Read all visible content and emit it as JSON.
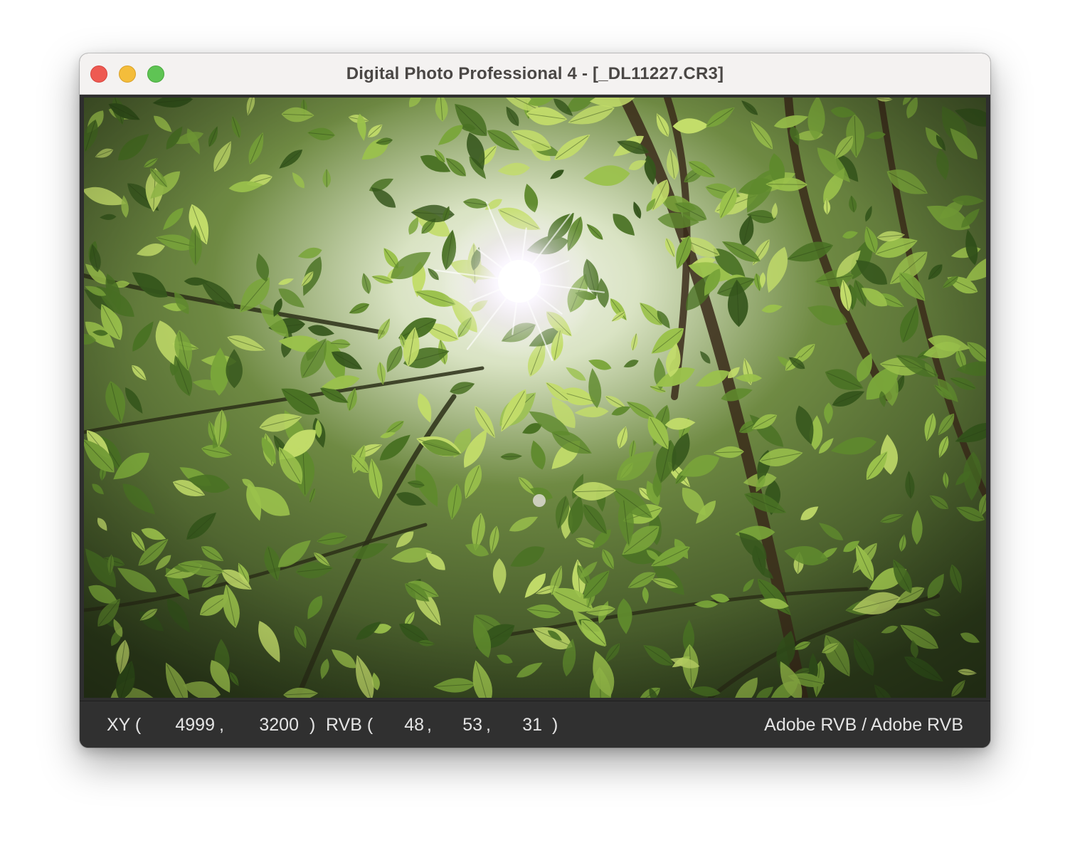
{
  "window": {
    "title": "Digital Photo Professional 4 - [_DL11227.CR3]"
  },
  "image": {
    "description": "",
    "sun_glow_color": "#ffffff",
    "leaf_colors": [
      "#5f8a2d",
      "#7aa63a",
      "#4a7224",
      "#9bc24c",
      "#35561c",
      "#c3dd6a"
    ]
  },
  "status": {
    "xy_label": "XY (",
    "x": "4999",
    "comma1": ",",
    "y": "3200",
    "close1": ")",
    "rgb_label": "RVB (",
    "r": "48",
    "comma2": ",",
    "g": "53",
    "comma3": ",",
    "b": "31",
    "close2": ")",
    "color_space": "Adobe RVB / Adobe RVB"
  }
}
